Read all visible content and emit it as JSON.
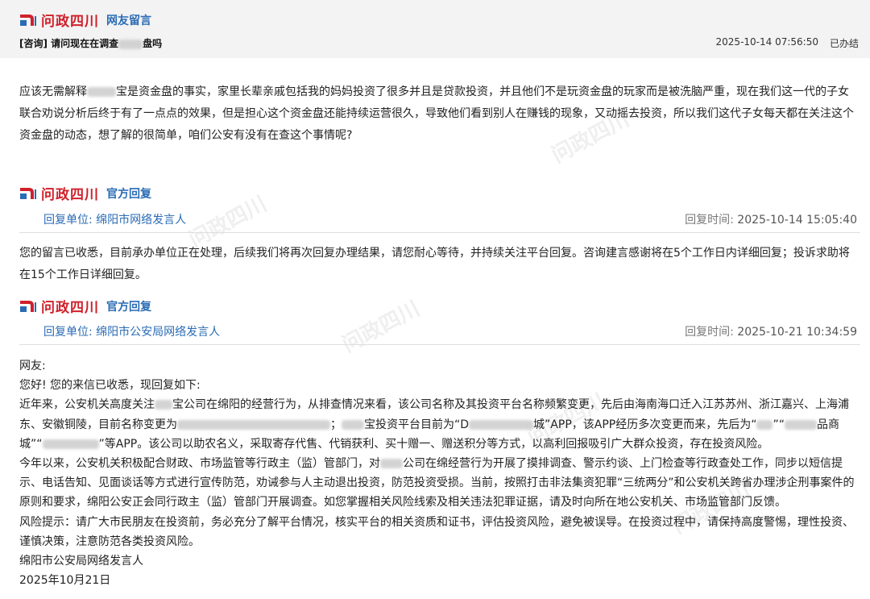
{
  "brand": "问政四川",
  "question": {
    "section_label": "网友留言",
    "title_prefix": "[咨询] 请问现在在调查",
    "title_suffix": "盘吗",
    "datetime": "2025-10-14 07:56:50",
    "status": "已办结",
    "content_part1": "应该无需解释",
    "content_part2": "宝是资金盘的事实，家里长辈亲戚包括我的妈妈投资了很多并且是贷款投资，并且他们不是玩资金盘的玩家而是被洗脑严重，现在我们这一代的子女联合劝说分析后终于有了一点点的效果，但是担心这个资金盘还能持续运营很久，导致他们看到别人在赚钱的现象，又动摇去投资，所以我们这代子女每天都在关注这个资金盘的动态，想了解的很简单，咱们公安有没有在查这个事情呢?"
  },
  "replies": [
    {
      "section_label": "官方回复",
      "unit_label": "回复单位:",
      "unit": "绵阳市网络发言人",
      "time_label": "回复时间:",
      "time": "2025-10-14 15:05:40",
      "content": "您的留言已收悉，目前承办单位正在处理，后续我们将再次回复办理结果，请您耐心等待，并持续关注平台回复。咨询建言感谢将在5个工作日内详细回复；投诉求助将在15个工作日详细回复。"
    },
    {
      "section_label": "官方回复",
      "unit_label": "回复单位:",
      "unit": "绵阳市公安局网络发言人",
      "time_label": "回复时间:",
      "time": "2025-10-21 10:34:59",
      "greeting": "网友:",
      "opening": "您好! 您的来信已收悉，现回复如下:",
      "p1_a": "近年来，公安机关高度关注",
      "p1_b": "宝公司在绵阳的经营行为，从排查情况来看，该公司名称及其投资平台名称频繁变更，先后由海南海口迁入江苏苏州、浙江嘉兴、上海浦东、安徽铜陵，目前名称变更为",
      "p1_c": "；",
      "p1_d": "宝投资平台目前为“D",
      "p1_e": "城”APP，该APP经历多次变更而来，先后为“",
      "p1_f": "”“",
      "p1_g": "品商城”“",
      "p1_h": "”等APP。该公司以助农名义，采取寄存代售、代销获利、买十赠一、赠送积分等方式，以高利回报吸引广大群众投资，存在投资风险。",
      "p2_a": "今年以来，公安机关积极配合财政、市场监管等行政主（监）管部门，对",
      "p2_b": "公司在绵经营行为开展了摸排调查、警示约谈、上门检查等行政查处工作，同步以短信提示、电话告知、见面谈话等方式进行宣传防范，劝诫参与人主动退出投资，防范投资受损。当前，按照打击非法集资犯罪“三统两分”和公安机关跨省办理涉企刑事案件的原则和要求，绵阳公安正会同行政主（监）管部门开展调查。如您掌握相关风险线索及相关违法犯罪证据，请及时向所在地公安机关、市场监管部门反馈。",
      "p3": "风险提示：请广大市民朋友在投资前，务必充分了解平台情况，核实平台的相关资质和证书，评估投资风险，避免被误导。在投资过程中，请保持高度警惕，理性投资、谨慎决策，注意防范各类投资风险。",
      "signature": "绵阳市公安局网络发言人",
      "date": "2025年10月21日"
    }
  ],
  "watermark_text": "问政四川",
  "colors": {
    "brand_red": "#d0202a",
    "link_blue": "#2a6bb5",
    "header_bg": "#f3f3f3"
  }
}
